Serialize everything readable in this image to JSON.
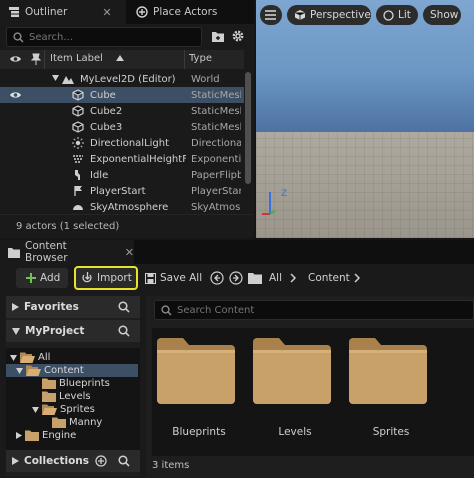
{
  "outliner": {
    "tab_label": "Outliner",
    "place_actors_label": "Place Actors",
    "close_glyph": "✕",
    "search_placeholder": "Search...",
    "col_item_label": "Item Label",
    "col_type": "Type",
    "rows": [
      {
        "label": "MyLevel2D (Editor)",
        "type": "World",
        "icon": "level-icon"
      },
      {
        "label": "Cube",
        "type": "StaticMesh",
        "icon": "cube-icon",
        "selected": true
      },
      {
        "label": "Cube2",
        "type": "StaticMesh",
        "icon": "cube-icon"
      },
      {
        "label": "Cube3",
        "type": "StaticMesh",
        "icon": "cube-icon"
      },
      {
        "label": "DirectionalLight",
        "type": "DirectionalL",
        "icon": "sun-icon"
      },
      {
        "label": "ExponentialHeightFog",
        "type": "ExponentialH",
        "icon": "fog-icon"
      },
      {
        "label": "Idle",
        "type": "PaperFlipbo",
        "icon": "flipbook-icon"
      },
      {
        "label": "PlayerStart",
        "type": "PlayerStart",
        "icon": "flag-icon"
      },
      {
        "label": "SkyAtmosphere",
        "type": "SkyAtmosph",
        "icon": "sky-icon"
      }
    ],
    "footer": "9 actors (1 selected)"
  },
  "viewport": {
    "perspective_label": "Perspective",
    "lit_label": "Lit",
    "show_label": "Show",
    "axis_z": "Z"
  },
  "content_browser": {
    "tab_label": "Content Browser",
    "close_glyph": "✕",
    "add_label": "Add",
    "import_label": "Import",
    "save_all_label": "Save All",
    "crumbs": [
      "All",
      "Content"
    ],
    "favorites_label": "Favorites",
    "project_label": "MyProject",
    "tree": [
      {
        "label": "All",
        "depth": 0,
        "expanded": true
      },
      {
        "label": "Content",
        "depth": 1,
        "expanded": true,
        "selected": true
      },
      {
        "label": "Blueprints",
        "depth": 2
      },
      {
        "label": "Levels",
        "depth": 2
      },
      {
        "label": "Sprites",
        "depth": 2,
        "expanded": true
      },
      {
        "label": "Manny",
        "depth": 3
      },
      {
        "label": "Engine",
        "depth": 1,
        "collapsed": true
      }
    ],
    "collections_label": "Collections",
    "search_placeholder": "Search Content",
    "assets": [
      "Blueprints",
      "Levels",
      "Sprites"
    ],
    "item_count": "3 items"
  },
  "colors": {
    "selection": "#3d4f64",
    "highlight_border": "#e6e32a",
    "folder": "#c8a06a",
    "add_plus": "#6fc34e"
  }
}
